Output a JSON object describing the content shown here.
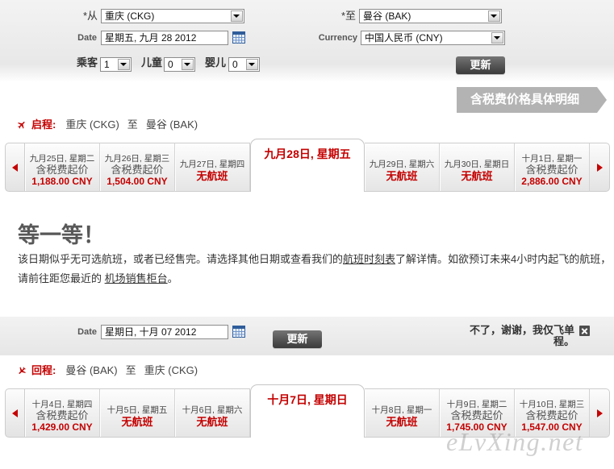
{
  "colors": {
    "accent": "#c40000",
    "banner": "#b3b3b3"
  },
  "search_form": {
    "from": {
      "label": "*从",
      "value": "重庆 (CKG)"
    },
    "to": {
      "label": "*至",
      "value": "曼谷 (BAK)"
    },
    "departure_date": {
      "label": "Date",
      "value": "星期五, 九月 28 2012",
      "icon": "calendar-icon"
    },
    "currency": {
      "label": "Currency",
      "value": "中国人民币 (CNY)"
    },
    "adults": {
      "label": "乘客",
      "value": "1"
    },
    "children": {
      "label": "儿童",
      "value": "0"
    },
    "infants": {
      "label": "婴儿",
      "value": "0"
    },
    "update_label": "更新"
  },
  "price_details_link": "含税费价格具体明细",
  "outbound": {
    "label": "启程:",
    "origin": "重庆 (CKG)",
    "connector": "至",
    "destination": "曼谷 (BAK)",
    "icon": "plane-icon",
    "days": [
      {
        "date": "九月25日, 星期二",
        "price_label": "含税费起价",
        "price": "1,188.00 CNY"
      },
      {
        "date": "九月26日, 星期三",
        "price_label": "含税费起价",
        "price": "1,504.00 CNY"
      },
      {
        "date": "九月27日, 星期四",
        "status": "无航班"
      },
      {
        "date": "九月28日, 星期五",
        "selected": true
      },
      {
        "date": "九月29日, 星期六",
        "status": "无航班"
      },
      {
        "date": "九月30日, 星期日",
        "status": "无航班"
      },
      {
        "date": "十月1日, 星期一",
        "price_label": "含税费起价",
        "price": "2,886.00 CNY"
      }
    ]
  },
  "no_flights_message": {
    "heading": "等一等！",
    "line1_before": "该日期似乎无可选航班，或者已经售完。请选择其他日期或查看我们的",
    "schedule_link": "航班时刻表",
    "line1_after": "了解详情。如欲预订未来4小时内起飞的航班，",
    "line2_before": "请前往距您最近的 ",
    "airport_link": "机场销售柜台",
    "line2_after": "。"
  },
  "return_form": {
    "date": {
      "label": "Date",
      "value": "星期日, 十月 07 2012",
      "icon": "calendar-icon"
    },
    "update_label": "更新",
    "one_way_text": "不了，谢谢，我仅飞单程。",
    "close_icon": "close-icon"
  },
  "return": {
    "label": "回程:",
    "origin": "曼谷 (BAK)",
    "connector": "至",
    "destination": "重庆 (CKG)",
    "icon": "plane-icon",
    "days": [
      {
        "date": "十月4日, 星期四",
        "price_label": "含税费起价",
        "price": "1,429.00 CNY"
      },
      {
        "date": "十月5日, 星期五",
        "status": "无航班"
      },
      {
        "date": "十月6日, 星期六",
        "status": "无航班"
      },
      {
        "date": "十月7日, 星期日",
        "selected": true
      },
      {
        "date": "十月8日, 星期一",
        "status": "无航班"
      },
      {
        "date": "十月9日, 星期二",
        "price_label": "含税费起价",
        "price": "1,745.00 CNY"
      },
      {
        "date": "十月10日, 星期三",
        "price_label": "含税费起价",
        "price": "1,547.00 CNY"
      }
    ]
  },
  "watermark": "eLvXing.net"
}
